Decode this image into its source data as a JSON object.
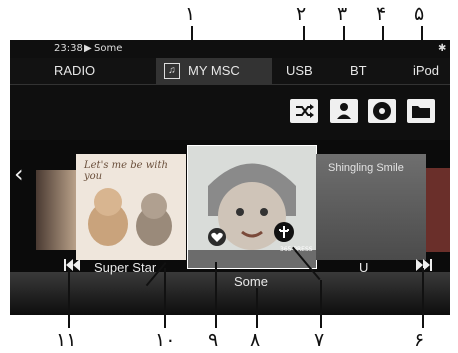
{
  "status": {
    "time": "23:38",
    "track": "Some"
  },
  "tabs": [
    {
      "label": "RADIO"
    },
    {
      "label": "MY MSC"
    },
    {
      "label": "USB"
    },
    {
      "label": "BT"
    },
    {
      "label": "iPod"
    }
  ],
  "controls": {
    "shuffle": "shuffle-icon",
    "artist": "person-icon",
    "disc": "disc-icon",
    "folder": "folder-icon"
  },
  "covers": {
    "left": {
      "text": "Let's me be with you"
    },
    "right": {
      "text": "Shingling Smile"
    },
    "center_badge": "365 PRESS"
  },
  "labels": {
    "left_title": "Super Star",
    "center_title": "Some",
    "right_title": "U"
  },
  "callouts": [
    "۱",
    "۲",
    "۳",
    "۴",
    "۵",
    "۶",
    "۷",
    "۸",
    "۹",
    "۱۰",
    "۱۱"
  ]
}
